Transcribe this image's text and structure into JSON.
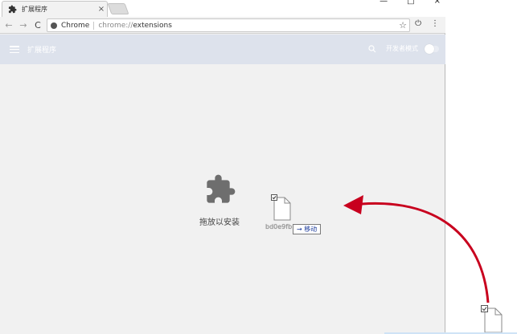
{
  "window": {
    "tab_title": "扩展程序",
    "tab_close": "×",
    "win_minimize": "—",
    "win_maximize": "□",
    "win_close": "×"
  },
  "toolbar": {
    "back": "←",
    "forward": "→",
    "reload": "C",
    "chip_label": "Chrome",
    "url_scheme": "chrome://",
    "url_path": "extensions",
    "star": "☆",
    "power": "⏻",
    "menu": "⋮"
  },
  "extensions_header": {
    "title": "扩展程序",
    "dev_mode_label": "开发者模式",
    "dev_mode_on": false
  },
  "content": {
    "drop_text": "拖放以安装",
    "drag_file_label": "bd0e9fb",
    "move_badge": "移动",
    "move_arrow": "→"
  },
  "colors": {
    "header_bg": "#dde2ec",
    "content_bg": "#f1f1f1",
    "arrow": "#c8001e",
    "move_text": "#1b3a9a"
  }
}
